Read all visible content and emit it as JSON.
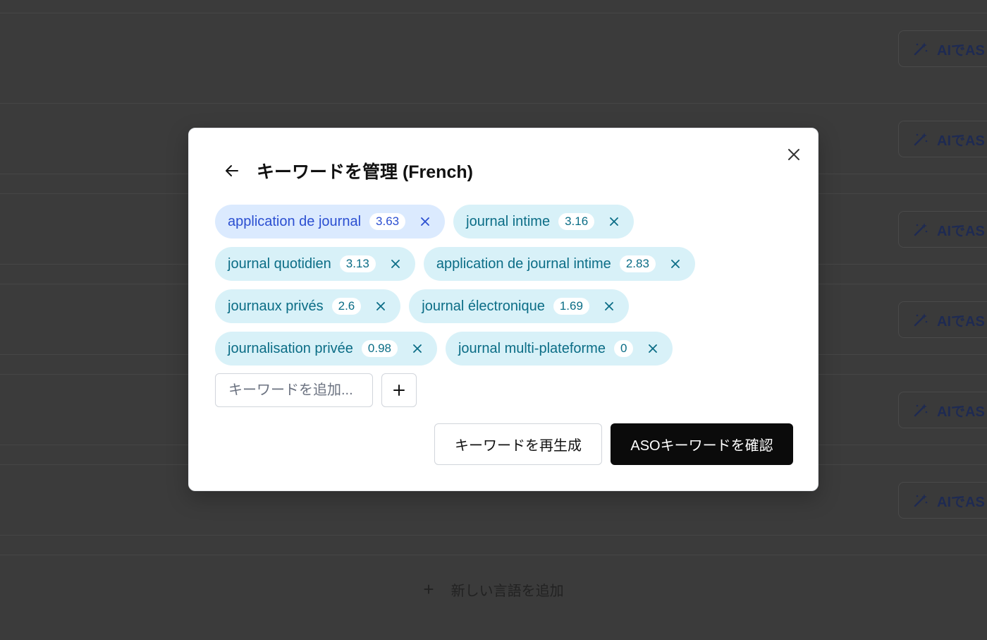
{
  "background": {
    "ai_button_label": "AIでAS",
    "ai_buttons": [
      {
        "label": "AIでAS"
      },
      {
        "label": "AIでAS"
      },
      {
        "label": "AIでAS"
      },
      {
        "label": "AIでAS"
      },
      {
        "label": "AIでAS"
      },
      {
        "label": "AIでAS"
      }
    ],
    "add_language_label": "新しい言語を追加"
  },
  "modal": {
    "title": "キーワードを管理 (French)",
    "keywords": [
      {
        "label": "application de journal",
        "score": "3.63",
        "selected": true
      },
      {
        "label": "journal intime",
        "score": "3.16",
        "selected": false
      },
      {
        "label": "journal quotidien",
        "score": "3.13",
        "selected": false
      },
      {
        "label": "application de journal intime",
        "score": "2.83",
        "selected": false
      },
      {
        "label": "journaux privés",
        "score": "2.6",
        "selected": false
      },
      {
        "label": "journal électronique",
        "score": "1.69",
        "selected": false
      },
      {
        "label": "journalisation privée",
        "score": "0.98",
        "selected": false
      },
      {
        "label": "journal multi-plateforme",
        "score": "0",
        "selected": false
      }
    ],
    "add_input": {
      "value": "",
      "placeholder": "キーワードを追加..."
    },
    "regenerate_label": "キーワードを再生成",
    "confirm_label": "ASOキーワードを確認"
  },
  "colors": {
    "chip_bg": "#d8f1f8",
    "chip_text": "#0b6d86",
    "chip_selected_bg": "#dbeafe",
    "chip_selected_text": "#2b4fd1",
    "primary_button": "#0b0b0b",
    "overlay": "#3b3b3b"
  },
  "icons": {
    "back": "arrow-left-icon",
    "close": "close-icon",
    "chip_remove": "x-icon",
    "add": "plus-icon",
    "ai": "magic-wand-icon"
  }
}
